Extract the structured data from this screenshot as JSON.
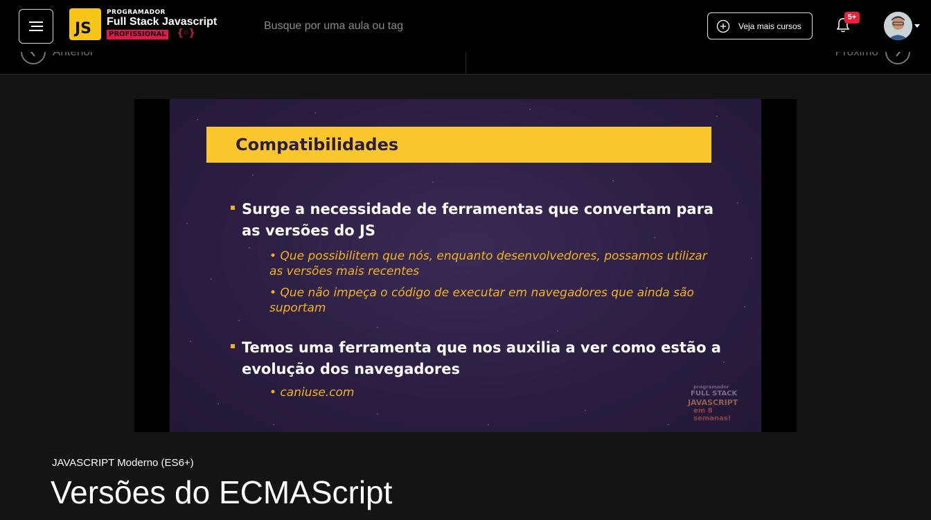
{
  "header": {
    "menu_icon": "hamburger-icon",
    "logo": {
      "badge": "JS",
      "line1": "PROGRAMADOR",
      "line2": "Full Stack Javascript",
      "line3": "PROFISSIONAL",
      "brace": "{◦}"
    },
    "search": {
      "placeholder": "Busque por uma aula ou tag",
      "value": ""
    },
    "courses_button": {
      "label": "Veja mais cursos",
      "icon": "plus-circle-icon"
    },
    "notifications": {
      "icon": "bell-icon",
      "badge": "5+"
    },
    "user": {
      "avatar_icon": "avatar",
      "menu_icon": "caret-down-icon"
    }
  },
  "nav": {
    "prev_label": "Anterior",
    "next_label": "Próximo",
    "prev_icon": "chevron-left-icon",
    "next_icon": "chevron-right-icon"
  },
  "slide": {
    "title": "Compatibilidades",
    "bullet1": {
      "line1": "Surge a necessidade de ferramentas que convertam para",
      "line2": "as versões do JS"
    },
    "sub1": {
      "line1": "• Que possibilitem que nós, enquanto desenvolvedores, possamos utilizar",
      "line2": "as versões mais recentes"
    },
    "sub2": {
      "line1": "• Que não impeça o código de executar em navegadores que ainda são",
      "line2": "suportam"
    },
    "bullet2": {
      "line1": "Temos uma ferramenta que nos auxilia a ver como estão a",
      "line2": "evolução dos navegadores"
    },
    "sub3": "• caniuse.com",
    "watermark": {
      "l1": "programador",
      "l2": "FULL STACK",
      "l3": "JAVASCRIPT",
      "l4": "em 8 semanas!"
    }
  },
  "lesson": {
    "course": "JAVASCRIPT Moderno (ES6+)",
    "title": "Versões do ECMAScript"
  },
  "colors": {
    "accent_yellow": "#fcc72c",
    "slide_bg": "#2a1d40",
    "badge_red": "#e8203a"
  }
}
